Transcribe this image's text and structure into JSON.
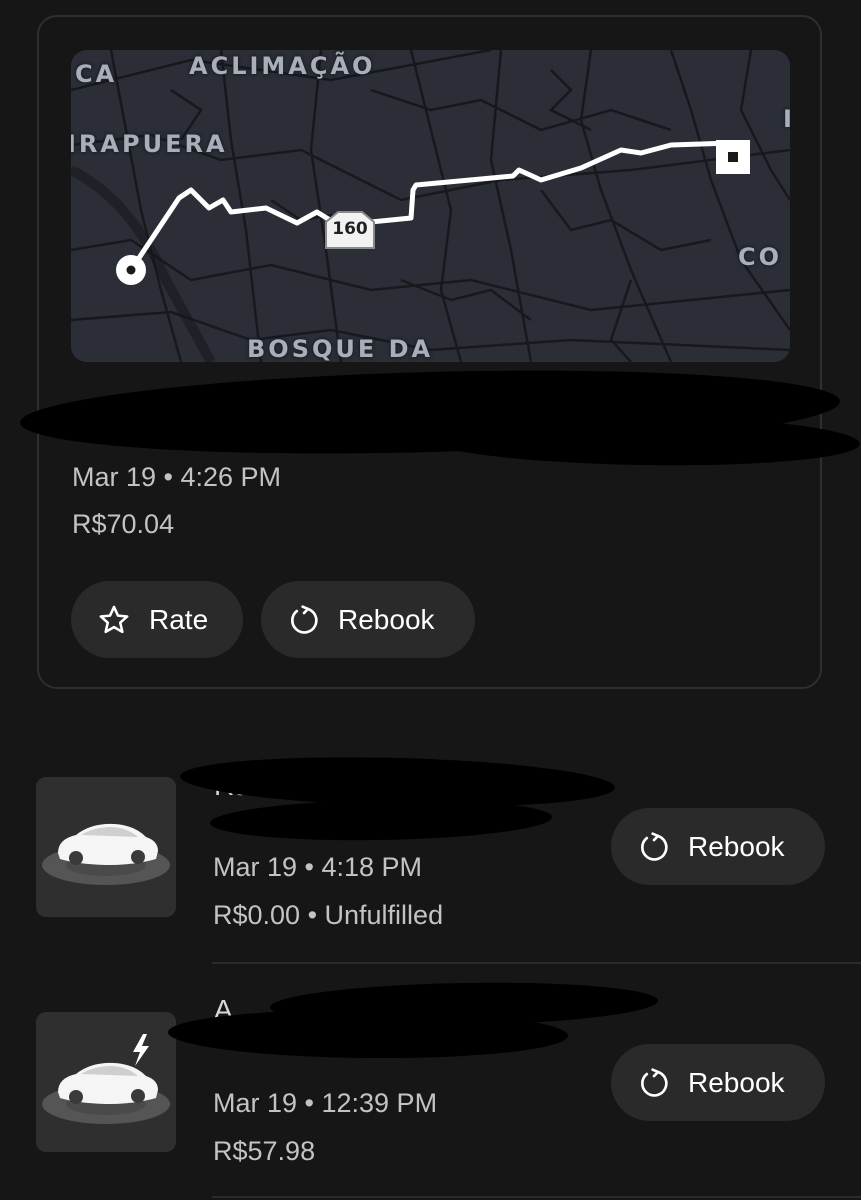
{
  "map": {
    "labels": [
      "CA",
      "ACLIMAÇÃO",
      "IRAPUERA",
      "BOSQUE DA",
      "CO",
      "I"
    ],
    "route_marker": "160",
    "start_icon": "origin-dot-icon",
    "end_icon": "destination-square-icon"
  },
  "trips": [
    {
      "date_time": "Mar 19 • 4:26 PM",
      "price": "R$70.04",
      "title_redacted": true,
      "actions": [
        {
          "label": "Rate",
          "icon": "star-icon"
        },
        {
          "label": "Rebook",
          "icon": "refresh-icon"
        }
      ]
    },
    {
      "date_time": "Mar 19 • 4:18 PM",
      "price_status": "R$0.00 • Unfulfilled",
      "vehicle_icon": "car-icon",
      "title_redacted": true,
      "action": {
        "label": "Rebook",
        "icon": "refresh-icon"
      }
    },
    {
      "date_time": "Mar 19 • 12:39 PM",
      "price": "R$57.98",
      "vehicle_icon": "electric-car-icon",
      "title_redacted": true,
      "action": {
        "label": "Rebook",
        "icon": "refresh-icon"
      }
    }
  ],
  "colors": {
    "background": "#161616",
    "card_border": "#2f2f2f",
    "pill": "#2a2a2a",
    "map": "#2b2e36",
    "route": "#ffffff"
  }
}
